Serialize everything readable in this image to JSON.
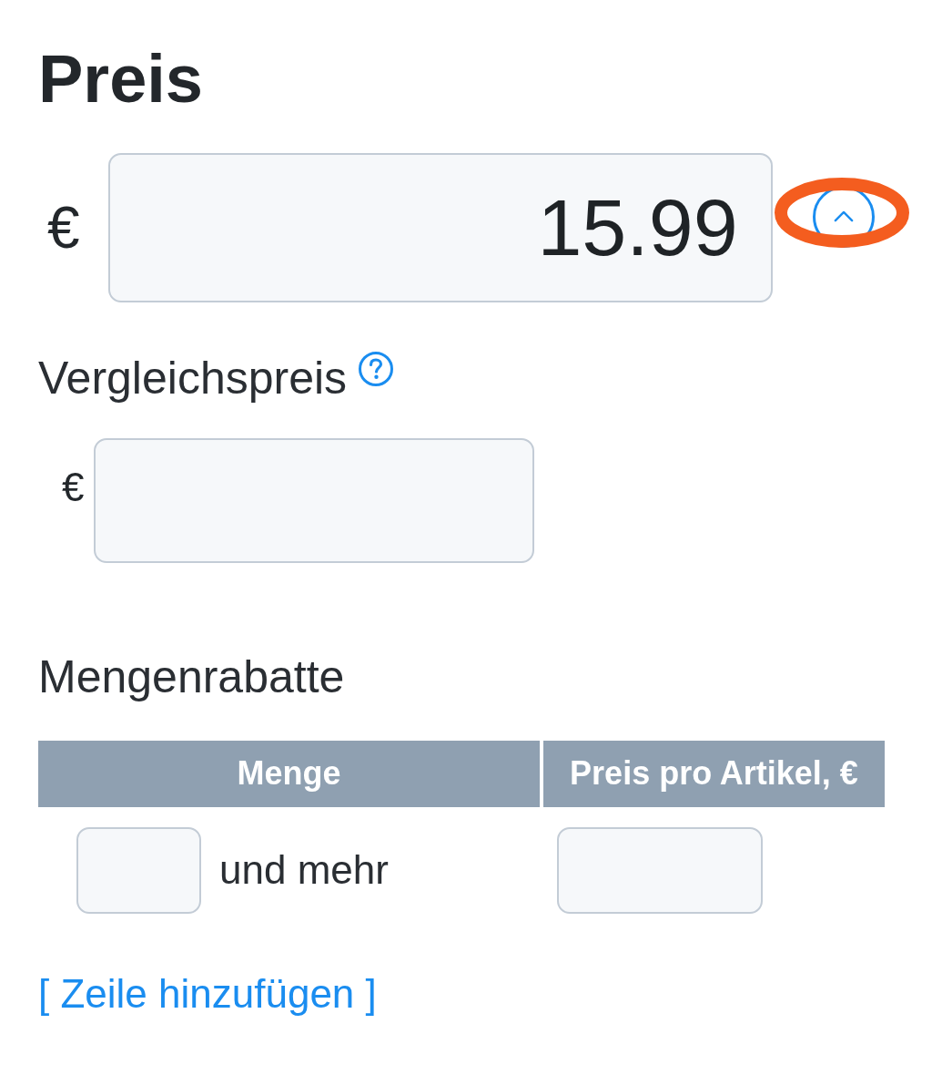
{
  "price": {
    "heading": "Preis",
    "currency": "€",
    "value": "15.99",
    "collapse_button": {
      "expanded": true,
      "highlighted": true
    }
  },
  "compare_price": {
    "label": "Vergleichspreis",
    "currency": "€"
  },
  "bulk_discounts": {
    "heading": "Mengenrabatte",
    "columns": [
      "Menge",
      "Preis pro Artikel, €"
    ],
    "rows": [
      {
        "suffix": "und mehr"
      }
    ],
    "add_row_link": "[ Zeile hinzufügen ]"
  }
}
